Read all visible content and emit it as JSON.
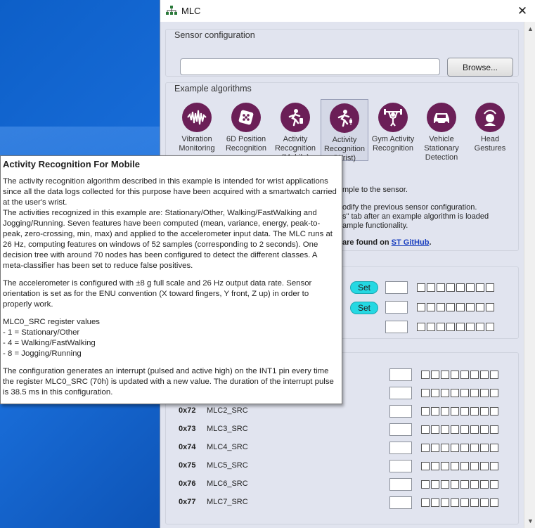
{
  "window": {
    "title": "MLC",
    "close_glyph": "✕"
  },
  "sensor_config": {
    "group_title": "Sensor configuration",
    "path_value": "",
    "browse_label": "Browse..."
  },
  "examples": {
    "group_title": "Example algorithms",
    "items": [
      {
        "label": "Vibration Monitoring",
        "icon": "vibration-icon",
        "selected": false
      },
      {
        "label": "6D Position Recognition",
        "icon": "dice-icon",
        "selected": false
      },
      {
        "label": "Activity Recognition (Mobile)",
        "icon": "running-phone-icon",
        "selected": false
      },
      {
        "label": "Activity Recognition (Wrist)",
        "icon": "running-watch-icon",
        "selected": true
      },
      {
        "label": "Gym Activity Recognition",
        "icon": "weightlifting-icon",
        "selected": false
      },
      {
        "label": "Vehicle Stationary Detection",
        "icon": "car-icon",
        "selected": false
      },
      {
        "label": "Head Gestures",
        "icon": "head-gesture-icon",
        "selected": false
      }
    ],
    "info_line1": "mple to the sensor.",
    "info_line2": "odify the previous sensor configuration.",
    "info_line3": "s\" tab after an example algorithm is loaded",
    "info_line4": "ample functionality.",
    "info_line5_prefix": "are found on ",
    "info_link": "ST GitHub",
    "info_line5_suffix": "."
  },
  "config_section": {
    "set_label": "Set"
  },
  "registers": [
    {
      "addr": "0x72",
      "name": "MLC2_SRC"
    },
    {
      "addr": "0x73",
      "name": "MLC3_SRC"
    },
    {
      "addr": "0x74",
      "name": "MLC4_SRC"
    },
    {
      "addr": "0x75",
      "name": "MLC5_SRC"
    },
    {
      "addr": "0x76",
      "name": "MLC6_SRC"
    },
    {
      "addr": "0x77",
      "name": "MLC7_SRC"
    }
  ],
  "tooltip": {
    "title": "Activity Recognition For Mobile",
    "p1": "The activity recognition algorithm described in this example is intended for wrist applications since all the data logs collected for this purpose have been acquired with a smartwatch carried at the user's wrist.\nThe activities recognized in this example are: Stationary/Other, Walking/FastWalking and Jogging/Running. Seven features have been computed (mean, variance, energy, peak-to-peak, zero-crossing, min, max) and applied to the accelerometer input data. The MLC runs at 26 Hz, computing features on windows of 52 samples (corresponding to 2 seconds). One decision tree with around 70 nodes has been configured to detect the different classes. A meta-classifier has been set to reduce false positives.",
    "p2": "The accelerometer is configured with ±8 g full scale and 26 Hz output data rate. Sensor orientation is set as for the ENU convention (X toward fingers, Y front, Z up) in order to properly work.",
    "p3": "MLC0_SRC register values\n- 1 = Stationary/Other\n- 4 = Walking/FastWalking\n- 8 = Jogging/Running",
    "p4": "The configuration generates an interrupt (pulsed and active high) on the INT1 pin every time the register MLC0_SRC (70h) is updated with a new value. The duration of the interrupt pulse is 38.5 ms in this configuration."
  },
  "colors": {
    "accent_icon": "#6b1f57",
    "set_button": "#25d8e2",
    "panel_bg": "#e1e4ef"
  }
}
